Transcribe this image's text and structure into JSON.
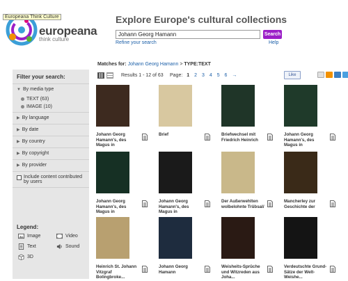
{
  "logo": {
    "tooltip": "Europeana Think Culture",
    "brand": "europeana",
    "tagline": "think culture"
  },
  "header": {
    "title": "Explore Europe's cultural collections",
    "search_value": "Johann Georg Hamann",
    "search_button": "Search",
    "refine_link": "Refine your search",
    "help_link": "Help"
  },
  "matches": {
    "label": "Matches for:",
    "query": "Johann Georg Hamann",
    "separator": ">",
    "filter": "TYPE:TEXT"
  },
  "sidebar": {
    "title": "Filter your search:",
    "media_type": "By media type",
    "sub_options": [
      "TEXT (63)",
      "IMAGE (10)"
    ],
    "facets": [
      "By language",
      "By date",
      "By country",
      "By copyright",
      "By provider"
    ],
    "include_ugc": "Include content contributed by users",
    "legend_title": "Legend:",
    "legend": {
      "image": "Image",
      "video": "Video",
      "text": "Text",
      "sound": "Sound",
      "3d": "3D"
    }
  },
  "toolbar": {
    "results": "Results 1 - 12 of 63",
    "page_label": "Page:",
    "pages": [
      "1",
      "2",
      "3",
      "4",
      "5",
      "6"
    ],
    "next": "→",
    "like": "Like"
  },
  "items": [
    {
      "title": "Johann Georg Hamann's, des Magus in",
      "thumb_color": "#3d2a1f"
    },
    {
      "title": "Brief",
      "thumb_color": "#d8c8a0"
    },
    {
      "title": "Briefwechsel mit Friedrich Heinrich",
      "thumb_color": "#1f3528"
    },
    {
      "title": "Johann Georg Hamann's, des Magus in",
      "thumb_color": "#1f3a2a"
    },
    {
      "title": "Johann Georg Hamann's, des Magus in",
      "thumb_color": "#163024"
    },
    {
      "title": "Johann Georg Hamann's, des Magus in",
      "thumb_color": "#1a1a1a"
    },
    {
      "title": "Der Außerwehlten wolbelohnte Trübsal/",
      "thumb_color": "#c9b88a"
    },
    {
      "title": "Mancherley zur Geschichte der",
      "thumb_color": "#3a2a18"
    },
    {
      "title": "Heinrich St. Johann Vitzgraf Bolingbroke...",
      "thumb_color": "#b8a070"
    },
    {
      "title": "Johann Georg Hamann",
      "thumb_color": "#1e2c3e"
    },
    {
      "title": "Weisheits-Sprüche und Witzreden aus Joha...",
      "thumb_color": "#2a1a14"
    },
    {
      "title": "Verdeutschte Grund-Sätze der Welt-Weishe...",
      "thumb_color": "#141414"
    }
  ],
  "colors": {
    "accent": "#9b1fc7",
    "link": "#1b5fa8",
    "sidebar_bg": "#e6e6e6"
  }
}
